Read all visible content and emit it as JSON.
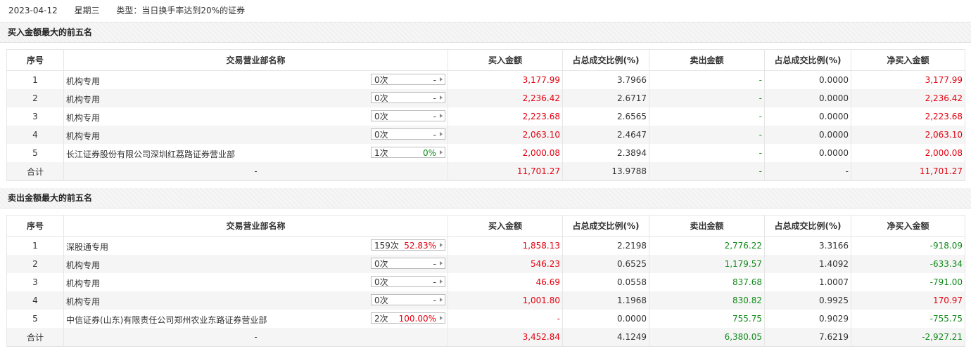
{
  "header": {
    "date": "2023-04-12",
    "weekday": "星期三",
    "type_text": "类型：当日换手率达到20%的证券"
  },
  "buy_section": {
    "title": "买入金额最大的前五名",
    "columns": [
      "序号",
      "交易营业部名称",
      "买入金额",
      "占总成交比例(%)",
      "卖出金额",
      "占总成交比例(%)",
      "净买入金额"
    ],
    "rows": [
      {
        "idx": "1",
        "name": "机构专用",
        "times": "0次",
        "pct": "-",
        "buy": "3,177.99",
        "buy_ratio": "3.7966",
        "sell": "-",
        "sell_ratio": "0.0000",
        "net": "3,177.99"
      },
      {
        "idx": "2",
        "name": "机构专用",
        "times": "0次",
        "pct": "-",
        "buy": "2,236.42",
        "buy_ratio": "2.6717",
        "sell": "-",
        "sell_ratio": "0.0000",
        "net": "2,236.42"
      },
      {
        "idx": "3",
        "name": "机构专用",
        "times": "0次",
        "pct": "-",
        "buy": "2,223.68",
        "buy_ratio": "2.6565",
        "sell": "-",
        "sell_ratio": "0.0000",
        "net": "2,223.68"
      },
      {
        "idx": "4",
        "name": "机构专用",
        "times": "0次",
        "pct": "-",
        "buy": "2,063.10",
        "buy_ratio": "2.4647",
        "sell": "-",
        "sell_ratio": "0.0000",
        "net": "2,063.10"
      },
      {
        "idx": "5",
        "name": "长江证券股份有限公司深圳红荔路证券营业部",
        "times": "1次",
        "pct": "0%",
        "buy": "2,000.08",
        "buy_ratio": "2.3894",
        "sell": "-",
        "sell_ratio": "0.0000",
        "net": "2,000.08"
      }
    ],
    "total": {
      "label": "合计",
      "name": "-",
      "buy": "11,701.27",
      "buy_ratio": "13.9788",
      "sell": "-",
      "sell_ratio": "-",
      "net": "11,701.27"
    }
  },
  "sell_section": {
    "title": "卖出金额最大的前五名",
    "columns": [
      "序号",
      "交易营业部名称",
      "买入金额",
      "占总成交比例(%)",
      "卖出金额",
      "占总成交比例(%)",
      "净买入金额"
    ],
    "rows": [
      {
        "idx": "1",
        "name": "深股通专用",
        "times": "159次",
        "pct": "52.83%",
        "buy": "1,858.13",
        "buy_ratio": "2.2198",
        "sell": "2,776.22",
        "sell_ratio": "3.3166",
        "net": "-918.09"
      },
      {
        "idx": "2",
        "name": "机构专用",
        "times": "0次",
        "pct": "-",
        "buy": "546.23",
        "buy_ratio": "0.6525",
        "sell": "1,179.57",
        "sell_ratio": "1.4092",
        "net": "-633.34"
      },
      {
        "idx": "3",
        "name": "机构专用",
        "times": "0次",
        "pct": "-",
        "buy": "46.69",
        "buy_ratio": "0.0558",
        "sell": "837.68",
        "sell_ratio": "1.0007",
        "net": "-791.00"
      },
      {
        "idx": "4",
        "name": "机构专用",
        "times": "0次",
        "pct": "-",
        "buy": "1,001.80",
        "buy_ratio": "1.1968",
        "sell": "830.82",
        "sell_ratio": "0.9925",
        "net": "170.97"
      },
      {
        "idx": "5",
        "name": "中信证券(山东)有限责任公司郑州农业东路证券营业部",
        "times": "2次",
        "pct": "100.00%",
        "buy": "-",
        "buy_ratio": "0.0000",
        "sell": "755.75",
        "sell_ratio": "0.9029",
        "net": "-755.75"
      }
    ],
    "total": {
      "label": "合计",
      "name": "-",
      "buy": "3,452.84",
      "buy_ratio": "4.1249",
      "sell": "6,380.05",
      "sell_ratio": "7.6219",
      "net": "-2,927.21"
    }
  },
  "colors": {
    "red": "#e4000f",
    "green": "#118a1b"
  }
}
